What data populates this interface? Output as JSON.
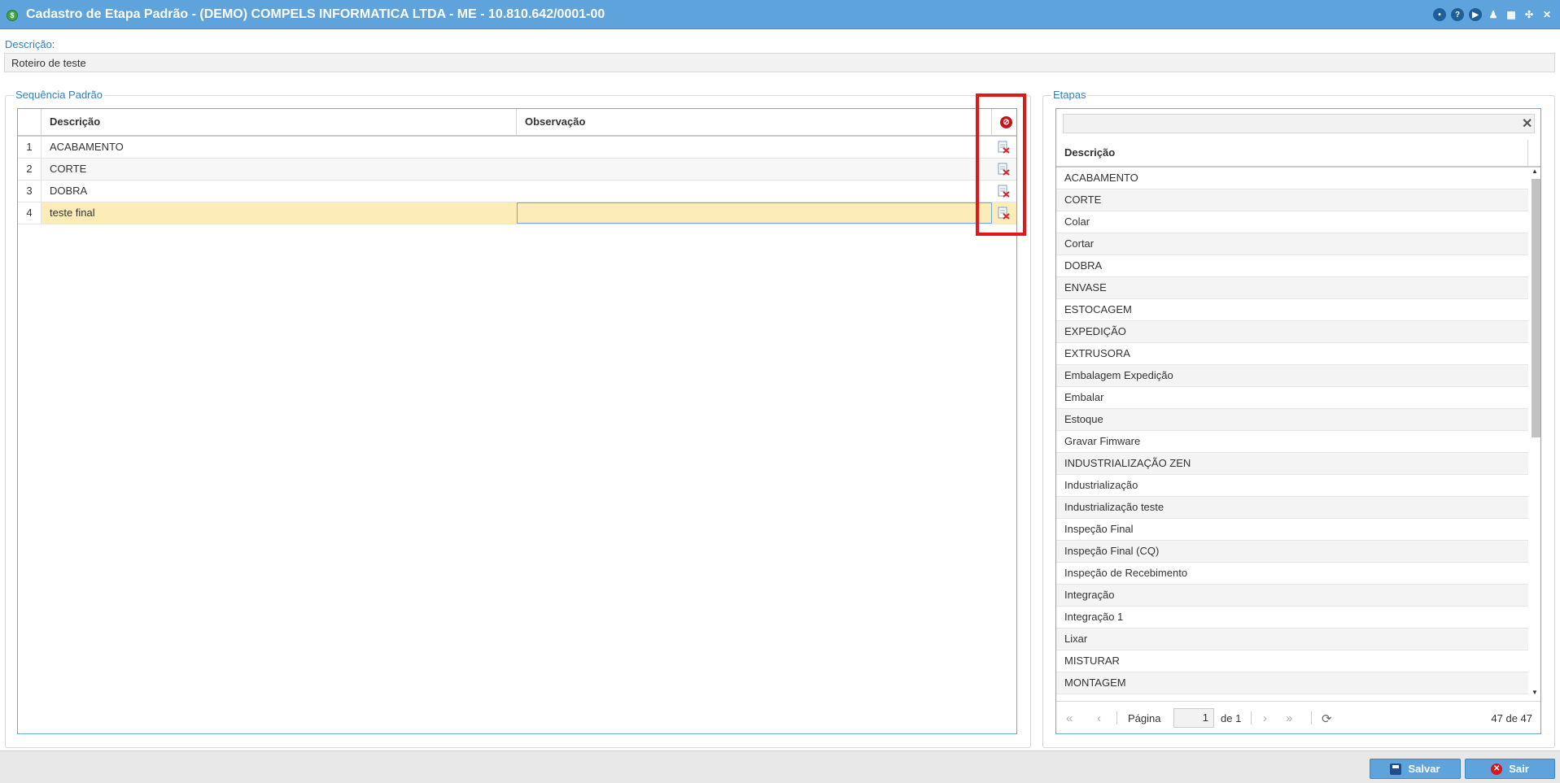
{
  "window": {
    "title": "Cadastro de Etapa Padrão - (DEMO) COMPELS INFORMATICA LTDA - ME - 10.810.642/0001-00"
  },
  "form": {
    "description_label": "Descrição:",
    "description_value": "Roteiro de teste"
  },
  "sequence": {
    "legend": "Sequência Padrão",
    "columns": {
      "description": "Descrição",
      "observation": "Observação"
    },
    "rows": [
      {
        "num": "1",
        "description": "ACABAMENTO",
        "observation": ""
      },
      {
        "num": "2",
        "description": "CORTE",
        "observation": ""
      },
      {
        "num": "3",
        "description": "DOBRA",
        "observation": ""
      },
      {
        "num": "4",
        "description": "teste final",
        "observation": ""
      }
    ]
  },
  "steps": {
    "legend": "Etapas",
    "column": "Descrição",
    "search_value": "",
    "items": [
      "ACABAMENTO",
      "CORTE",
      "Colar",
      "Cortar",
      "DOBRA",
      "ENVASE",
      "ESTOCAGEM",
      "EXPEDIÇÃO",
      "EXTRUSORA",
      "Embalagem Expedição",
      "Embalar",
      "Estoque",
      "Gravar Fimware",
      "INDUSTRIALIZAÇÃO ZEN",
      "Industrialização",
      "Industrialização teste",
      "Inspeção Final",
      "Inspeção Final (CQ)",
      "Inspeção de Recebimento",
      "Integração",
      "Integração 1",
      "Lixar",
      "MISTURAR",
      "MONTAGEM"
    ],
    "pager": {
      "page_label": "Página",
      "page_value": "1",
      "of_label": "de 1",
      "info": "47 de 47"
    }
  },
  "footer": {
    "save_label": "Salvar",
    "exit_label": "Sair"
  },
  "colors": {
    "titlebar": "#5ea3dc",
    "accent": "#2f7fc4",
    "selected_row": "#fcecb8",
    "highlight": "#e01818"
  }
}
